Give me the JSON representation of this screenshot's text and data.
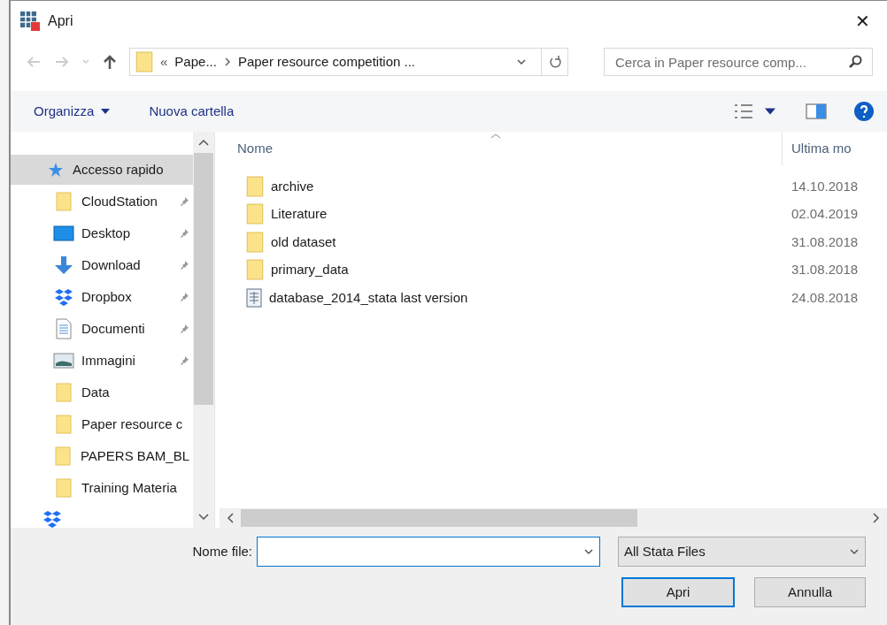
{
  "window": {
    "title": "Apri",
    "close": "✕"
  },
  "address": {
    "prefix": "«",
    "crumbs": [
      "Pape...",
      "Paper resource competition ..."
    ]
  },
  "search": {
    "placeholder": "Cerca in Paper resource comp..."
  },
  "toolbar": {
    "organize": "Organizza",
    "new_folder": "Nuova cartella"
  },
  "sidebar": {
    "items": [
      {
        "kind": "quick",
        "label": "Accesso rapido",
        "pinned": false,
        "selected": true
      },
      {
        "kind": "folder",
        "label": "CloudStation",
        "pinned": true,
        "selected": false
      },
      {
        "kind": "desktop",
        "label": "Desktop",
        "pinned": true,
        "selected": false
      },
      {
        "kind": "download",
        "label": "Download",
        "pinned": true,
        "selected": false
      },
      {
        "kind": "dropbox",
        "label": "Dropbox",
        "pinned": true,
        "selected": false
      },
      {
        "kind": "documents",
        "label": "Documenti",
        "pinned": true,
        "selected": false
      },
      {
        "kind": "pictures",
        "label": "Immagini",
        "pinned": true,
        "selected": false
      },
      {
        "kind": "folder",
        "label": "Data",
        "pinned": false,
        "selected": false
      },
      {
        "kind": "folder",
        "label": "Paper resource c",
        "pinned": false,
        "selected": false
      },
      {
        "kind": "folder",
        "label": "PAPERS BAM_BL",
        "pinned": false,
        "selected": false
      },
      {
        "kind": "folder",
        "label": "Training Materia",
        "pinned": false,
        "selected": false
      }
    ]
  },
  "table": {
    "columns": [
      "Nome",
      "Ultima mo"
    ],
    "rows": [
      {
        "kind": "folder",
        "name": "archive",
        "date": "14.10.2018"
      },
      {
        "kind": "folder",
        "name": "Literature",
        "date": "02.04.2019"
      },
      {
        "kind": "folder",
        "name": "old dataset",
        "date": "31.08.2018"
      },
      {
        "kind": "folder",
        "name": "primary_data",
        "date": "31.08.2018"
      },
      {
        "kind": "file",
        "name": "database_2014_stata last version",
        "date": "24.08.2018"
      }
    ]
  },
  "footer": {
    "filename_label": "Nome file:",
    "filter": "All Stata Files",
    "open": "Apri",
    "cancel": "Annulla"
  }
}
